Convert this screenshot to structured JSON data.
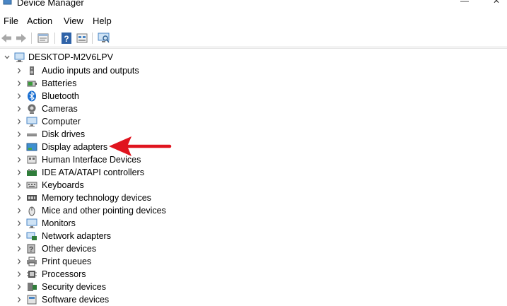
{
  "window": {
    "title": "Device Manager",
    "minimize_glyph": "—",
    "close_glyph": "✕"
  },
  "menu": [
    "File",
    "Action",
    "View",
    "Help"
  ],
  "toolbar": {
    "buttons": [
      "back-arrow-icon",
      "forward-arrow-icon",
      "properties-icon",
      "help-icon",
      "show-hidden-icon",
      "scan-hardware-icon"
    ]
  },
  "tree": {
    "root": "DESKTOP-M2V6LPV",
    "items": [
      {
        "label": "Audio inputs and outputs",
        "icon": "speaker-icon"
      },
      {
        "label": "Batteries",
        "icon": "battery-icon"
      },
      {
        "label": "Bluetooth",
        "icon": "bluetooth-icon"
      },
      {
        "label": "Cameras",
        "icon": "camera-icon"
      },
      {
        "label": "Computer",
        "icon": "monitor-icon"
      },
      {
        "label": "Disk drives",
        "icon": "disk-drive-icon"
      },
      {
        "label": "Display adapters",
        "icon": "display-adapter-icon"
      },
      {
        "label": "Human Interface Devices",
        "icon": "hid-icon"
      },
      {
        "label": "IDE ATA/ATAPI controllers",
        "icon": "ide-controller-icon"
      },
      {
        "label": "Keyboards",
        "icon": "keyboard-icon"
      },
      {
        "label": "Memory technology devices",
        "icon": "memory-icon"
      },
      {
        "label": "Mice and other pointing devices",
        "icon": "mouse-icon"
      },
      {
        "label": "Monitors",
        "icon": "monitor-icon"
      },
      {
        "label": "Network adapters",
        "icon": "network-adapter-icon"
      },
      {
        "label": "Other devices",
        "icon": "unknown-device-icon"
      },
      {
        "label": "Print queues",
        "icon": "printer-icon"
      },
      {
        "label": "Processors",
        "icon": "processor-icon"
      },
      {
        "label": "Security devices",
        "icon": "security-device-icon"
      },
      {
        "label": "Software devices",
        "icon": "software-device-icon"
      }
    ]
  },
  "annotation": {
    "color": "#e0141e",
    "points_to": "Display adapters"
  }
}
